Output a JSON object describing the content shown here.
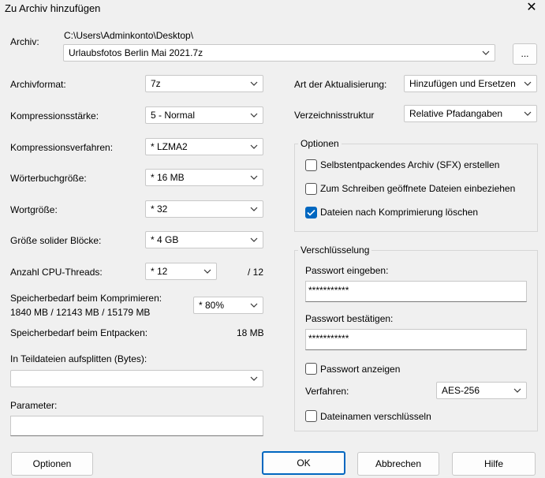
{
  "window": {
    "title": "Zu Archiv hinzufügen",
    "close_glyph": "✕"
  },
  "archive": {
    "label": "Archiv:",
    "path": "C:\\Users\\Adminkonto\\Desktop\\",
    "filename": "Urlaubsfotos Berlin Mai 2021.7z",
    "browse_label": "..."
  },
  "left": {
    "format_label": "Archivformat:",
    "format_value": "7z",
    "level_label": "Kompressionsstärke:",
    "level_value": "5 - Normal",
    "method_label": "Kompressionsverfahren:",
    "method_value": "* LZMA2",
    "dict_label": "Wörterbuchgröße:",
    "dict_value": "* 16 MB",
    "word_label": "Wortgröße:",
    "word_value": "* 32",
    "solid_label": "Größe solider Blöcke:",
    "solid_value": "* 4 GB",
    "threads_label": "Anzahl CPU-Threads:",
    "threads_value": "* 12",
    "threads_max": "/ 12",
    "mem_comp_label": "Speicherbedarf beim Komprimieren:",
    "mem_comp_value": "1840 MB / 12143 MB / 15179 MB",
    "mem_comp_select": "* 80%",
    "mem_decomp_label": "Speicherbedarf beim Entpacken:",
    "mem_decomp_value": "18 MB",
    "split_label": "In Teildateien aufsplitten (Bytes):",
    "split_value": "",
    "params_label": "Parameter:",
    "params_value": ""
  },
  "right": {
    "update_label": "Art der Aktualisierung:",
    "update_value": "Hinzufügen und Ersetzen",
    "paths_label": "Verzeichnisstruktur",
    "paths_value": "Relative Pfadangaben",
    "options_title": "Optionen",
    "opt_sfx": {
      "label": "Selbstentpackendes Archiv (SFX) erstellen",
      "checked": false
    },
    "opt_shared": {
      "label": "Zum Schreiben geöffnete Dateien einbeziehen",
      "checked": false
    },
    "opt_delete": {
      "label": "Dateien nach Komprimierung löschen",
      "checked": true
    },
    "enc_title": "Verschlüsselung",
    "pw_label": "Passwort eingeben:",
    "pw_value": "***********",
    "pw2_label": "Passwort bestätigen:",
    "pw2_value": "***********",
    "show_pw": {
      "label": "Passwort anzeigen",
      "checked": false
    },
    "method_label": "Verfahren:",
    "method_value": "AES-256",
    "enc_names": {
      "label": "Dateinamen verschlüsseln",
      "checked": false
    }
  },
  "buttons": {
    "options": "Optionen",
    "ok": "OK",
    "cancel": "Abbrechen",
    "help": "Hilfe"
  }
}
